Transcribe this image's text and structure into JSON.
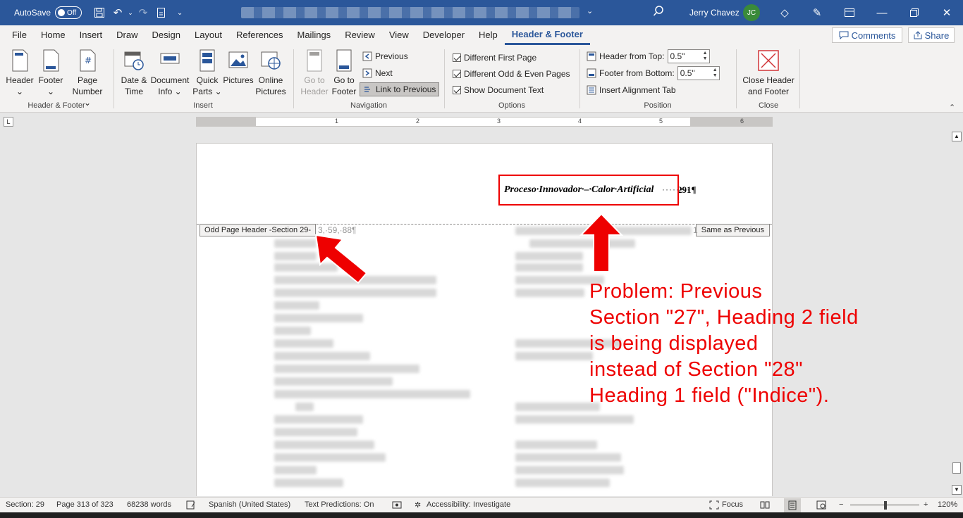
{
  "titlebar": {
    "autosave_label": "AutoSave",
    "autosave_state": "Off",
    "user_name": "Jerry Chavez",
    "user_initials": "JC"
  },
  "menu": {
    "tabs": [
      "File",
      "Home",
      "Insert",
      "Draw",
      "Design",
      "Layout",
      "References",
      "Mailings",
      "Review",
      "View",
      "Developer",
      "Help",
      "Header & Footer"
    ],
    "comments_label": "Comments",
    "share_label": "Share"
  },
  "ribbon": {
    "header_footer_group": {
      "label": "Header & Footer",
      "header_l1": "Header",
      "header_l2": "⌄",
      "footer_l1": "Footer",
      "footer_l2": "⌄",
      "pagenum_l1": "Page",
      "pagenum_l2": "Number ⌄"
    },
    "insert_group": {
      "label": "Insert",
      "datetime_l1": "Date &",
      "datetime_l2": "Time",
      "docinfo_l1": "Document",
      "docinfo_l2": "Info ⌄",
      "quickparts_l1": "Quick",
      "quickparts_l2": "Parts ⌄",
      "pictures_l1": "Pictures",
      "online_l1": "Online",
      "online_l2": "Pictures"
    },
    "navigation_group": {
      "label": "Navigation",
      "gotoheader_l1": "Go to",
      "gotoheader_l2": "Header",
      "gotofooter_l1": "Go to",
      "gotofooter_l2": "Footer",
      "previous": "Previous",
      "next": "Next",
      "link_previous": "Link to Previous"
    },
    "options_group": {
      "label": "Options",
      "diff_first": "Different First Page",
      "diff_odd_even": "Different Odd & Even Pages",
      "show_doc_text": "Show Document Text"
    },
    "position_group": {
      "label": "Position",
      "header_from_top": "Header from Top:",
      "header_from_top_value": "0.5\"",
      "footer_from_bottom": "Footer from Bottom:",
      "footer_from_bottom_value": "0.5\"",
      "insert_alignment_tab": "Insert Alignment Tab"
    },
    "close_group": {
      "label": "Close",
      "close_l1": "Close Header",
      "close_l2": "and Footer"
    }
  },
  "ruler": {
    "numbers": [
      "1",
      "2",
      "3",
      "4",
      "5",
      "6"
    ]
  },
  "document": {
    "header_text": "Proceso·Innovador·–·Calor·Artificial",
    "header_dots": "·····•··",
    "header_page_num": "291¶",
    "left_tag": "Odd Page Header -Section 29-",
    "right_tag": "Same as Previous",
    "faded_text": "3,·59,·88¶",
    "faded_text_right": "1"
  },
  "annotation": {
    "line1": "Problem: Previous",
    "line2": "Section \"27\", Heading 2 field",
    "line3": "is being displayed",
    "line4": "instead of Section \"28\"",
    "line5": "Heading 1 field (\"Indice\")."
  },
  "statusbar": {
    "section": "Section: 29",
    "page": "Page 313 of 323",
    "words": "68238 words",
    "language": "Spanish (United States)",
    "text_predictions": "Text Predictions: On",
    "accessibility": "Accessibility: Investigate",
    "focus": "Focus",
    "zoom": "120%"
  },
  "colors": {
    "titlebar": "#2b579a",
    "annotation_red": "#e00000"
  }
}
